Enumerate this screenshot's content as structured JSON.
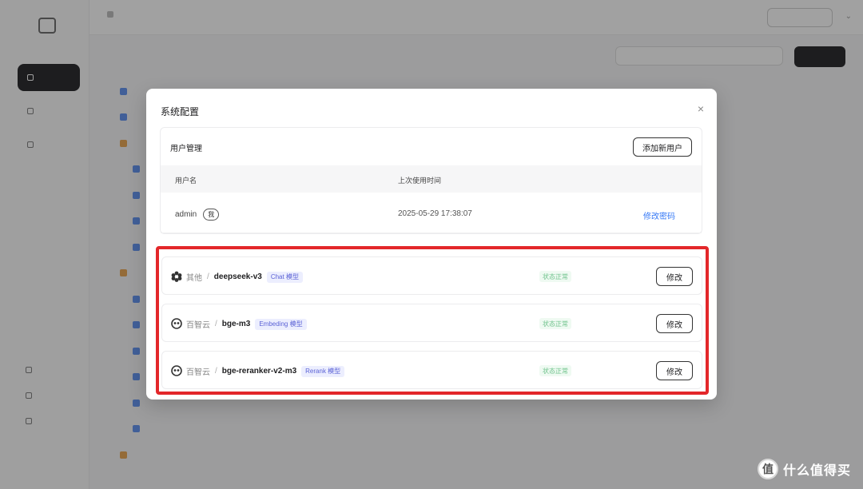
{
  "modal": {
    "title": "系统配置",
    "close_icon": "×",
    "users": {
      "heading": "用户管理",
      "add_button": "添加新用户",
      "columns": [
        "用户名",
        "上次使用时间"
      ],
      "rows": [
        {
          "username": "admin",
          "badge": "我",
          "last_used": "2025-05-29 17:38:07",
          "action": "修改密码"
        }
      ]
    },
    "models": [
      {
        "icon": "hexagon-cluster-icon",
        "provider": "其他",
        "separator": "/",
        "model": "deepseek-v3",
        "tag": "Chat 模型",
        "status": "状态正常",
        "action": "修改"
      },
      {
        "icon": "baidu-cloud-icon",
        "provider": "百智云",
        "separator": "/",
        "model": "bge-m3",
        "tag": "Embeding 模型",
        "status": "状态正常",
        "action": "修改"
      },
      {
        "icon": "baidu-cloud-icon",
        "provider": "百智云",
        "separator": "/",
        "model": "bge-reranker-v2-m3",
        "tag": "Rerank 模型",
        "status": "状态正常",
        "action": "修改"
      }
    ],
    "highlight_color": "#e3272a"
  },
  "watermark": {
    "logo": "值",
    "text": "什么值得买"
  },
  "colors": {
    "link": "#3478f6",
    "status": "#6fc38c",
    "tag": "#5b62d6"
  }
}
